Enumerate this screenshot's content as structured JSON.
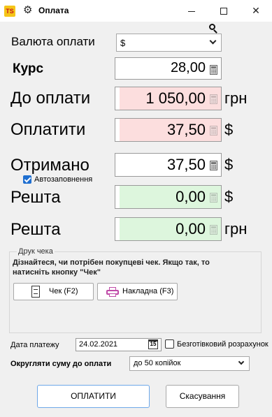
{
  "window": {
    "logo_text": "TS",
    "title": "Оплата",
    "minimize_glyph": "–",
    "close_glyph": "✕"
  },
  "form": {
    "currency_label": "Валюта оплати",
    "currency_value": "$",
    "rate_label": "Курс",
    "rate_value": "28,00",
    "due_label": "До оплати",
    "due_value": "1 050,00",
    "due_unit": "грн",
    "pay_label": "Оплатити",
    "pay_value": "37,50",
    "pay_unit": "$",
    "received_label": "Отримано",
    "received_value": "37,50",
    "received_unit": "$",
    "autofill_label": "Автозаповнення",
    "autofill_checked": true,
    "change_label": "Решта",
    "change_usd_value": "0,00",
    "change_usd_unit": "$",
    "change_uah_value": "0,00",
    "change_uah_unit": "грн"
  },
  "receipt_group": {
    "title": "Друк чека",
    "hint": "Дізнайтеся, чи потрібен покупцеві чек. Якщо так, то натисніть кнопку \"Чек\"",
    "check_button": "Чек (F2)",
    "invoice_button": "Накладна (F3)"
  },
  "payment": {
    "date_label": "Дата платежу",
    "date_value": "24.02.2021",
    "calendar_icon_text": "15",
    "cashless_label": "Безготівковий розрахунок",
    "cashless_checked": false,
    "round_label": "Округляти суму до оплати",
    "round_value": "до 50 копійок"
  },
  "actions": {
    "pay_button": "ОПЛАТИТИ",
    "cancel_button": "Скасування"
  },
  "colors": {
    "due_field_bg": "#fcdede",
    "change_field_bg": "#ddf6dd",
    "checkbox_accent": "#1f6fd0",
    "pay_button_border": "#6ea8e8"
  },
  "icons": [
    "app-logo",
    "gear-icon",
    "search-icon",
    "calculator-icon",
    "receipt-icon",
    "printer-icon",
    "calendar-icon",
    "chevron-down-icon"
  ]
}
